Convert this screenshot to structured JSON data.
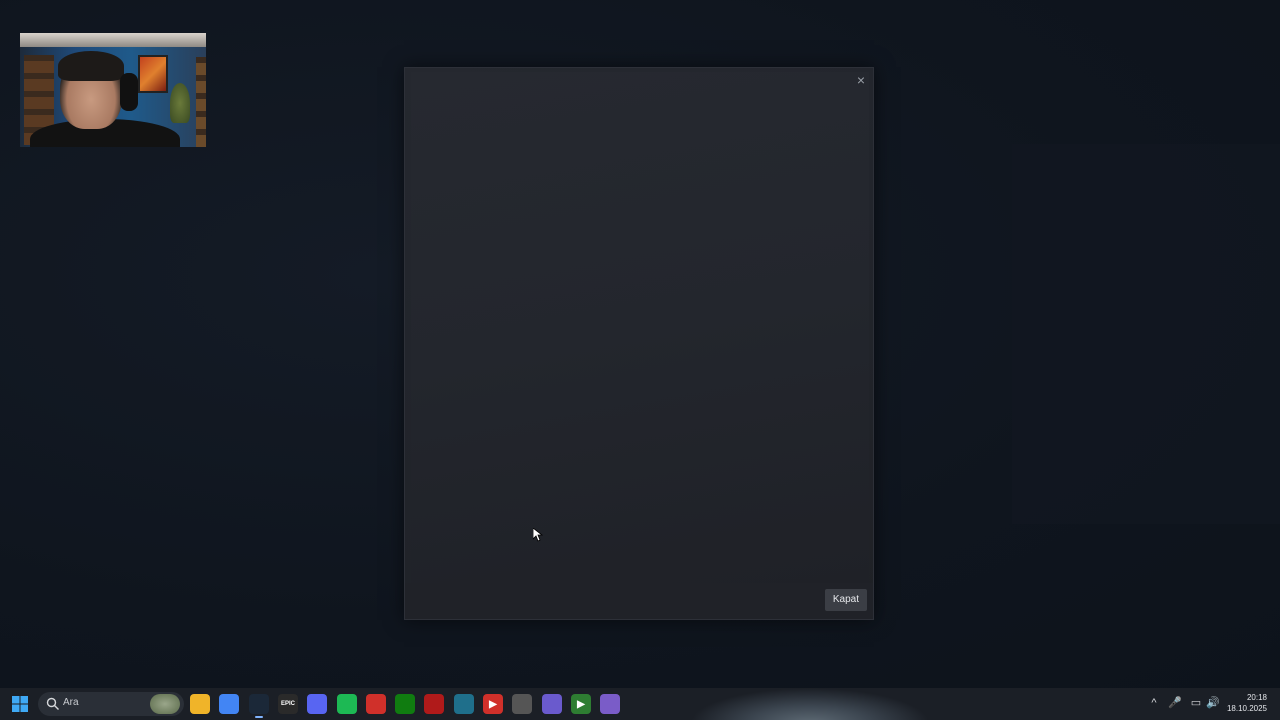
{
  "dialog": {
    "close_glyph": "×",
    "close_button_label": "Kapat"
  },
  "taskbar": {
    "search_placeholder": "Ara",
    "apps": [
      {
        "name": "file-explorer-icon",
        "glyph": "",
        "color": "#f0b429"
      },
      {
        "name": "chrome-icon",
        "glyph": "",
        "color": "#4285f4"
      },
      {
        "name": "steam-icon",
        "glyph": "",
        "color": "#1b2838"
      },
      {
        "name": "epic-games-icon",
        "glyph": "EPIC",
        "color": "#2a2a2a"
      },
      {
        "name": "discord-icon",
        "glyph": "",
        "color": "#5865f2"
      },
      {
        "name": "spotify-icon",
        "glyph": "",
        "color": "#1db954"
      },
      {
        "name": "app-red-icon",
        "glyph": "",
        "color": "#d0302a"
      },
      {
        "name": "xbox-icon",
        "glyph": "",
        "color": "#107c10"
      },
      {
        "name": "app-red-bar-icon",
        "glyph": "",
        "color": "#b01a1a"
      },
      {
        "name": "app-teal-icon",
        "glyph": "",
        "color": "#1f6f8b"
      },
      {
        "name": "media-player-icon",
        "glyph": "▶",
        "color": "#d0302a"
      },
      {
        "name": "app-gear-icon",
        "glyph": "",
        "color": "#555"
      },
      {
        "name": "app-ring-icon",
        "glyph": "",
        "color": "#6a5acd"
      },
      {
        "name": "app-green-play-icon",
        "glyph": "▶",
        "color": "#2e7d32"
      },
      {
        "name": "app-chat-icon",
        "glyph": "",
        "color": "#7a5cc8"
      }
    ],
    "tray": {
      "chevron": "^",
      "mic": "🎤",
      "network": "▭",
      "volume": "🔊"
    },
    "clock_time": "20:18",
    "clock_date": "18.10.2025"
  }
}
